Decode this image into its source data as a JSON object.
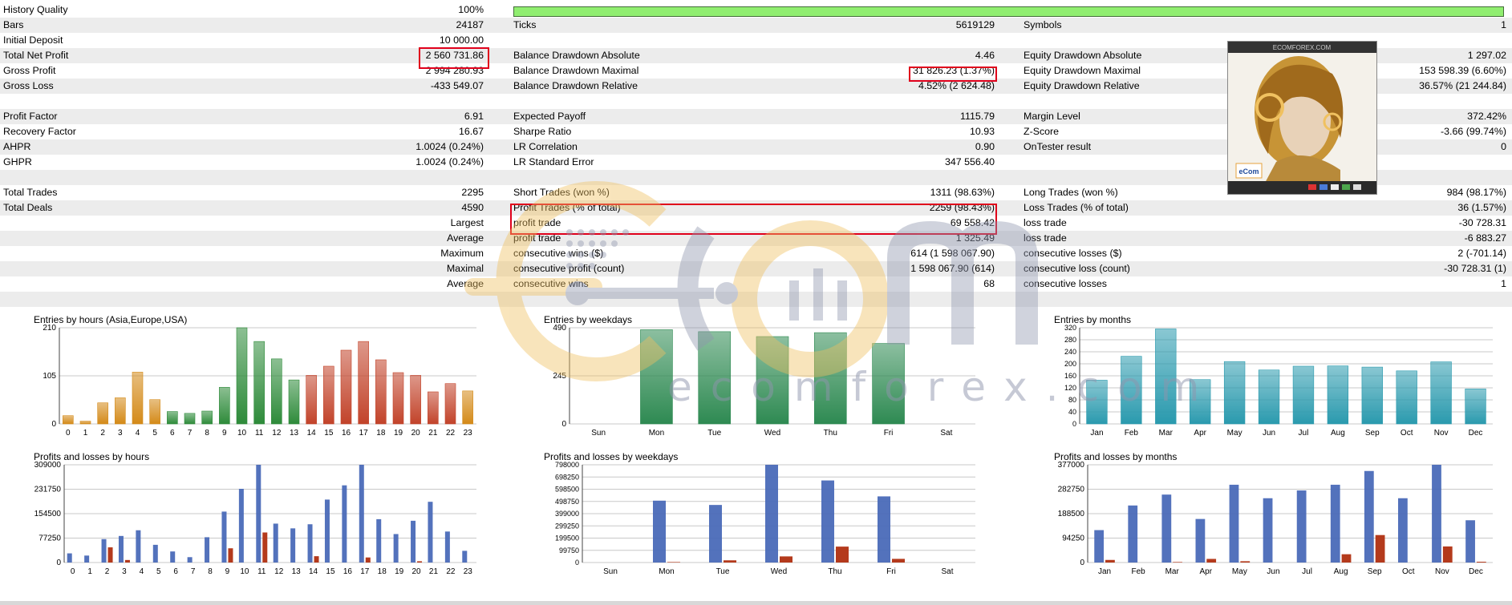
{
  "report": {
    "history_quality": {
      "label": "History Quality",
      "value": "100%",
      "fraction": 1.0
    },
    "rows": [
      {
        "shade": true,
        "c1": "Bars",
        "v1": "24187",
        "c2": "Ticks",
        "v2": "5619129",
        "c3": "Symbols",
        "v3": "1"
      },
      {
        "shade": false,
        "c1": "Initial Deposit",
        "v1": "10 000.00",
        "c2": "",
        "v2": "",
        "c3": "",
        "v3": ""
      },
      {
        "shade": true,
        "c1": "Total Net Profit",
        "v1": "2 560 731.86",
        "c2": "Balance Drawdown Absolute",
        "v2": "4.46",
        "c3": "Equity Drawdown Absolute",
        "v3": "1 297.02"
      },
      {
        "shade": false,
        "c1": "Gross Profit",
        "v1": "2 994 280.93",
        "c2": "Balance Drawdown Maximal",
        "v2": "31 826.23 (1.37%)",
        "c3": "Equity Drawdown Maximal",
        "v3": "153 598.39 (6.60%)"
      },
      {
        "shade": true,
        "c1": "Gross Loss",
        "v1": "-433 549.07",
        "c2": "Balance Drawdown Relative",
        "v2": "4.52% (2 624.48)",
        "c3": "Equity Drawdown Relative",
        "v3": "36.57% (21 244.84)"
      },
      {
        "shade": false,
        "c1": "",
        "v1": "",
        "c2": "",
        "v2": "",
        "c3": "",
        "v3": ""
      },
      {
        "shade": true,
        "c1": "Profit Factor",
        "v1": "6.91",
        "c2": "Expected Payoff",
        "v2": "1115.79",
        "c3": "Margin Level",
        "v3": "372.42%"
      },
      {
        "shade": false,
        "c1": "Recovery Factor",
        "v1": "16.67",
        "c2": "Sharpe Ratio",
        "v2": "10.93",
        "c3": "Z-Score",
        "v3": "-3.66 (99.74%)"
      },
      {
        "shade": true,
        "c1": "AHPR",
        "v1": "1.0024 (0.24%)",
        "c2": "LR Correlation",
        "v2": "0.90",
        "c3": "OnTester result",
        "v3": "0"
      },
      {
        "shade": false,
        "c1": "GHPR",
        "v1": "1.0024 (0.24%)",
        "c2": "LR Standard Error",
        "v2": "347 556.40",
        "c3": "",
        "v3": ""
      },
      {
        "shade": true,
        "c1": "",
        "v1": "",
        "c2": "",
        "v2": "",
        "c3": "",
        "v3": ""
      },
      {
        "shade": false,
        "c1": "Total Trades",
        "v1": "2295",
        "c2": "Short Trades (won %)",
        "v2": "1311 (98.63%)",
        "c3": "Long Trades (won %)",
        "v3": "984 (98.17%)"
      },
      {
        "shade": true,
        "c1": "Total Deals",
        "v1": "4590",
        "c2": "Profit Trades (% of total)",
        "v2": "2259 (98.43%)",
        "c3": "Loss Trades (% of total)",
        "v3": "36 (1.57%)"
      },
      {
        "shade": false,
        "c1": "",
        "v1": "Largest",
        "c2": "profit trade",
        "v2": "69 558.42",
        "c3": "loss trade",
        "v3": "-30 728.31"
      },
      {
        "shade": true,
        "c1": "",
        "v1": "Average",
        "c2": "profit trade",
        "v2": "1 325.49",
        "c3": "loss trade",
        "v3": "-6 883.27"
      },
      {
        "shade": false,
        "c1": "",
        "v1": "Maximum",
        "c2": "consecutive wins ($)",
        "v2": "614 (1 598 067.90)",
        "c3": "consecutive losses ($)",
        "v3": "2 (-701.14)"
      },
      {
        "shade": true,
        "c1": "",
        "v1": "Maximal",
        "c2": "consecutive profit (count)",
        "v2": "1 598 067.90 (614)",
        "c3": "consecutive loss (count)",
        "v3": "-30 728.31 (1)"
      },
      {
        "shade": false,
        "c1": "",
        "v1": "Average",
        "c2": "consecutive wins",
        "v2": "68",
        "c3": "consecutive losses",
        "v3": "1"
      },
      {
        "shade": true,
        "c1": "",
        "v1": "",
        "c2": "",
        "v2": "",
        "c3": "",
        "v3": ""
      }
    ]
  },
  "watermark": {
    "logo_text": "eCom",
    "site_text": "ecomforex.com",
    "avatar_caption": "ECOMFOREX.COM"
  },
  "colors": {
    "green_bar": "#90ee70",
    "highlight": "#e0001b",
    "profit_blue": "#4a6ab8",
    "loss_red": "#b43a1c",
    "asia": "#d48a18",
    "europe": "#2e8b3a",
    "usa": "#c2432a",
    "weekday": "#2e8a52",
    "month": "#2a9aae"
  },
  "chart_data": [
    {
      "type": "bar",
      "title": "Entries by hours (Asia,Europe,USA)",
      "categories": [
        "0",
        "1",
        "2",
        "3",
        "4",
        "5",
        "6",
        "7",
        "8",
        "9",
        "10",
        "11",
        "12",
        "13",
        "14",
        "15",
        "16",
        "17",
        "18",
        "19",
        "20",
        "21",
        "22",
        "23"
      ],
      "values": [
        18,
        6,
        46,
        57,
        113,
        53,
        27,
        23,
        28,
        80,
        210,
        180,
        142,
        96,
        106,
        126,
        161,
        180,
        140,
        112,
        106,
        70,
        88,
        72
      ],
      "ylim": [
        0,
        210
      ],
      "yticks": [
        "0",
        "105",
        "210"
      ],
      "groups": [
        "asia",
        "asia",
        "asia",
        "asia",
        "asia",
        "asia",
        "europe",
        "europe",
        "europe",
        "europe",
        "europe",
        "europe",
        "europe",
        "europe",
        "usa",
        "usa",
        "usa",
        "usa",
        "usa",
        "usa",
        "usa",
        "usa",
        "usa",
        "asia"
      ]
    },
    {
      "type": "bar",
      "title": "Entries by weekdays",
      "categories": [
        "Sun",
        "Mon",
        "Tue",
        "Wed",
        "Thu",
        "Fri",
        "Sat"
      ],
      "values": [
        0,
        480,
        470,
        445,
        465,
        410,
        0
      ],
      "ylim": [
        0,
        490
      ],
      "yticks": [
        "0",
        "245",
        "490"
      ]
    },
    {
      "type": "bar",
      "title": "Entries by months",
      "categories": [
        "Jan",
        "Feb",
        "Mar",
        "Apr",
        "May",
        "Jun",
        "Jul",
        "Aug",
        "Sep",
        "Oct",
        "Nov",
        "Dec"
      ],
      "values": [
        150,
        232,
        326,
        152,
        214,
        185,
        198,
        199,
        195,
        182,
        213,
        120
      ],
      "ylim": [
        0,
        330
      ],
      "yticks": [
        "0",
        "40",
        "80",
        "120",
        "160",
        "200",
        "240",
        "280",
        "320"
      ]
    },
    {
      "type": "bar",
      "title": "Profits and losses by hours",
      "categories": [
        "0",
        "1",
        "2",
        "3",
        "4",
        "5",
        "6",
        "7",
        "8",
        "9",
        "10",
        "11",
        "12",
        "13",
        "14",
        "15",
        "16",
        "17",
        "18",
        "19",
        "20",
        "21",
        "22",
        "23"
      ],
      "series": [
        {
          "values": [
            29000,
            22000,
            74000,
            84000,
            102000,
            56000,
            35000,
            17000,
            80000,
            161000,
            233000,
            309000,
            123000,
            108000,
            121000,
            199000,
            244000,
            309000,
            137000,
            90000,
            132000,
            192000,
            98000,
            37000
          ]
        },
        {
          "values": [
            0,
            0,
            48000,
            8000,
            0,
            0,
            0,
            0,
            0,
            45000,
            0,
            95000,
            0,
            0,
            20000,
            0,
            0,
            16000,
            0,
            0,
            4000,
            0,
            0,
            0
          ]
        }
      ],
      "ylim": [
        0,
        309000
      ],
      "yticks": [
        "0",
        "77250",
        "154500",
        "231750",
        "309000"
      ]
    },
    {
      "type": "bar",
      "title": "Profits and losses by weekdays",
      "categories": [
        "Sun",
        "Mon",
        "Tue",
        "Wed",
        "Thu",
        "Fri",
        "Sat"
      ],
      "series": [
        {
          "values": [
            0,
            505000,
            470000,
            798000,
            670000,
            540000,
            0
          ]
        },
        {
          "values": [
            0,
            4000,
            18000,
            50000,
            130000,
            30000,
            0
          ]
        }
      ],
      "ylim": [
        0,
        798000
      ],
      "yticks": [
        "0",
        "99750",
        "199500",
        "299250",
        "399000",
        "498750",
        "598500",
        "698250",
        "798000"
      ]
    },
    {
      "type": "bar",
      "title": "Profits and losses by months",
      "categories": [
        "Jan",
        "Feb",
        "Mar",
        "Apr",
        "May",
        "Jun",
        "Jul",
        "Aug",
        "Sep",
        "Oct",
        "Nov",
        "Dec"
      ],
      "series": [
        {
          "values": [
            125000,
            220000,
            262000,
            168000,
            300000,
            248000,
            278000,
            300000,
            353000,
            248000,
            377000,
            163000
          ]
        },
        {
          "values": [
            10000,
            0,
            2000,
            14000,
            5000,
            0,
            0,
            32000,
            106000,
            0,
            62000,
            3000
          ]
        }
      ],
      "ylim": [
        0,
        377000
      ],
      "yticks": [
        "0",
        "94250",
        "188500",
        "282750",
        "377000"
      ]
    }
  ]
}
